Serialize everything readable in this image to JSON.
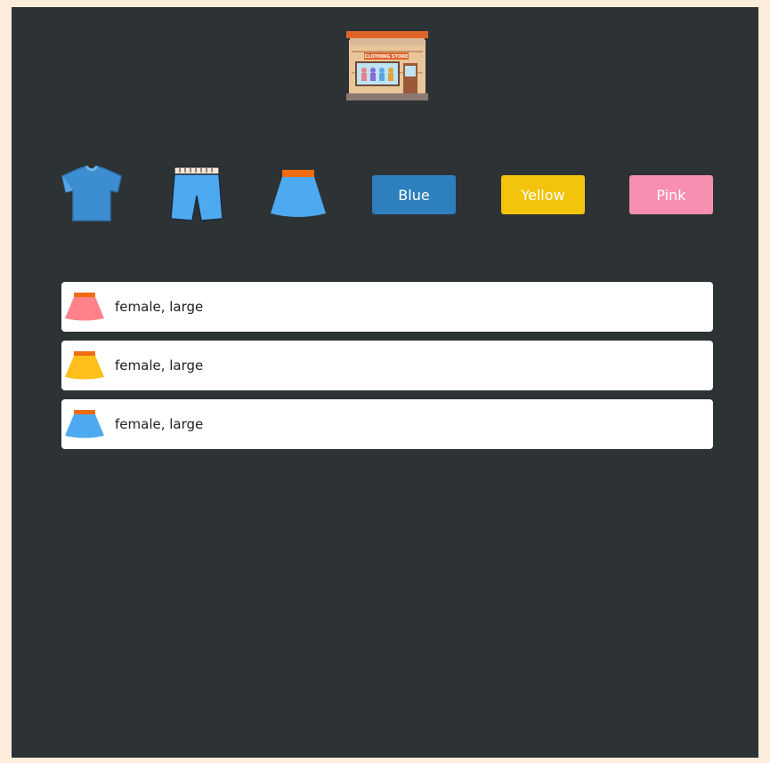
{
  "header": {
    "logo_icon": "clothing-store-icon",
    "logo_text": "CLOTHING STORE"
  },
  "toolbar": {
    "garments": [
      {
        "name": "tshirt",
        "icon": "tshirt-icon",
        "color": "#3d8ed1"
      },
      {
        "name": "shorts",
        "icon": "shorts-icon",
        "color": "#4eaaf0"
      },
      {
        "name": "skirt",
        "icon": "skirt-icon",
        "color": "#4eaaf0"
      }
    ],
    "colors": [
      {
        "label": "Blue",
        "hex": "#2e7fbd"
      },
      {
        "label": "Yellow",
        "hex": "#f2c40c"
      },
      {
        "label": "Pink",
        "hex": "#f78fb0"
      }
    ]
  },
  "results": [
    {
      "icon": "skirt-icon",
      "color": "#ff8189",
      "text": "female, large"
    },
    {
      "icon": "skirt-icon",
      "color": "#ffbf1a",
      "text": "female, large"
    },
    {
      "icon": "skirt-icon",
      "color": "#4eaaf0",
      "text": "female, large"
    }
  ]
}
